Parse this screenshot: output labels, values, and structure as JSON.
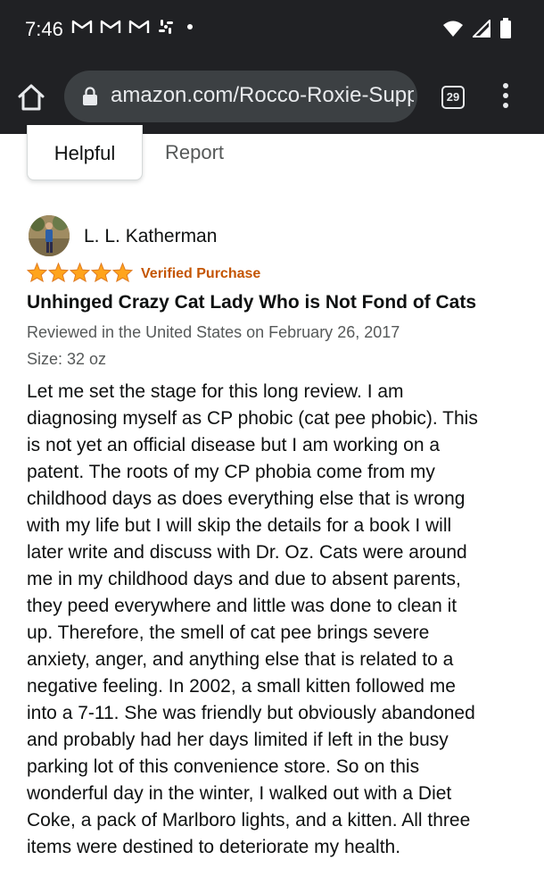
{
  "status_bar": {
    "time": "7:46",
    "notification_icons": [
      "gmail-icon",
      "gmail-icon",
      "gmail-icon",
      "slack-icon"
    ],
    "right_icons": [
      "wifi-icon",
      "signal-icon",
      "battery-icon"
    ]
  },
  "browser": {
    "url": "amazon.com/Rocco-Roxie-Supp",
    "tab_count": "29"
  },
  "review_actions": {
    "helpful_label": "Helpful",
    "report_label": "Report"
  },
  "review": {
    "reviewer_name": "L. L. Katherman",
    "rating": 5,
    "rating_max": 5,
    "verified_label": "Verified Purchase",
    "title": "Unhinged Crazy Cat Lady Who is Not Fond of Cats",
    "date_line": "Reviewed in the United States on February 26, 2017",
    "size_line": "Size: 32 oz",
    "body_lines": [
      "Let me set the stage for this long review. I am",
      "diagnosing myself as CP phobic (cat pee phobic). This",
      "is not yet an official disease but I am working on a",
      "patent. The roots of my CP phobia come from my",
      "childhood days as does everything else that is wrong",
      "with my life but I will skip the details for a book I will",
      "later write and discuss with Dr. Oz. Cats were around",
      "me in my childhood days and due to absent parents,",
      "they peed everywhere and little was done to clean it",
      "up. Therefore, the smell of cat pee brings severe",
      "anxiety, anger, and anything else that is related to a",
      "negative feeling. In 2002, a small kitten followed me",
      "into a 7-11. She was friendly but obviously abandoned",
      "and probably had her days limited if left in the busy",
      "parking lot of this convenience store. So on this",
      "wonderful day in the winter, I walked out with a Diet",
      "Coke, a pack of Marlboro lights, and a kitten. All three",
      "items were destined to deteriorate my health."
    ]
  },
  "colors": {
    "star": "#ffa41c",
    "verified": "#c45500",
    "chrome_bg": "#202124",
    "url_pill": "#3c4043"
  }
}
